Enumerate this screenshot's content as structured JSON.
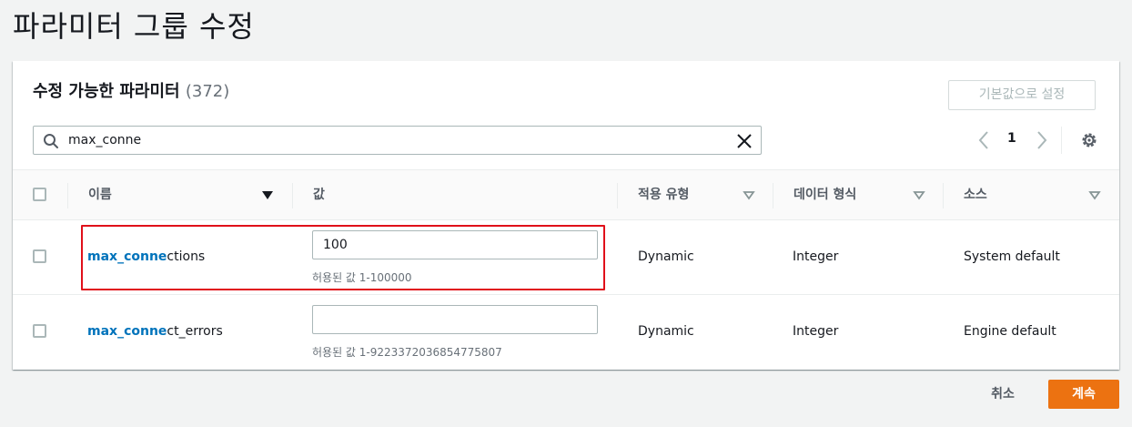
{
  "page": {
    "title": "파라미터 그룹 수정"
  },
  "panel": {
    "title": "수정 가능한 파라미터",
    "count": "(372)",
    "reset_label": "기본값으로 설정"
  },
  "search": {
    "value": "max_conne",
    "icon": "search-icon",
    "clear_icon": "close-icon"
  },
  "pagination": {
    "current_page": "1"
  },
  "table": {
    "columns": [
      {
        "label": "이름",
        "sorted": "descending"
      },
      {
        "label": "값"
      },
      {
        "label": "적용 유형"
      },
      {
        "label": "데이터 형식"
      },
      {
        "label": "소스"
      }
    ],
    "rows": [
      {
        "name_match": "max_conne",
        "name_rest": "ctions",
        "value": "100",
        "hint": "허용된 값 1-100000",
        "apply_type": "Dynamic",
        "data_type": "Integer",
        "source": "System default",
        "highlighted": true
      },
      {
        "name_match": "max_conne",
        "name_rest": "ct_errors",
        "value": "",
        "hint": "허용된 값 1-9223372036854775807",
        "apply_type": "Dynamic",
        "data_type": "Integer",
        "source": "Engine default",
        "highlighted": false
      }
    ]
  },
  "footer": {
    "cancel_label": "취소",
    "continue_label": "계속"
  },
  "colors": {
    "accent": "#ec7211",
    "link": "#0073bb",
    "highlight_border": "#e0101a"
  }
}
